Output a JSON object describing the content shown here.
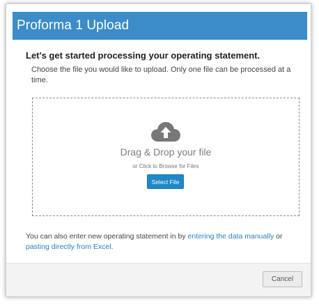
{
  "header": {
    "title": "Proforma 1 Upload"
  },
  "intro": {
    "heading": "Let's get started processing your operating statement.",
    "instructions": "Choose the file you would like to upload. Only one file can be processed at a time."
  },
  "dropzone": {
    "icon": "cloud-upload-icon",
    "title": "Drag & Drop your file",
    "subtitle": "or Click to Browse for Files",
    "select_label": "Select File"
  },
  "alternatives": {
    "prefix": "You can also enter new operating statement in by ",
    "manual_link": "entering the data manually",
    "middle": " or ",
    "excel_link": "pasting directly from Excel",
    "suffix": "."
  },
  "footer": {
    "cancel_label": "Cancel"
  },
  "colors": {
    "header_bg": "#3b8cc9",
    "primary_button": "#1e88c8",
    "link": "#2b7fc2"
  }
}
